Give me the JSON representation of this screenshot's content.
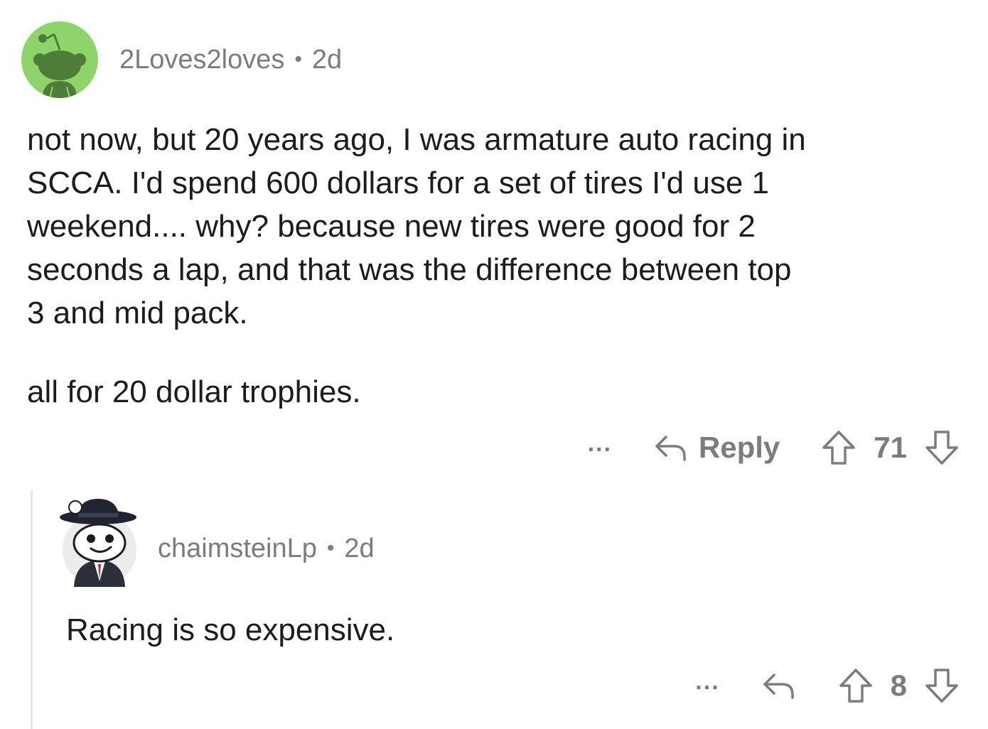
{
  "comment": {
    "username": "2Loves2loves",
    "separator": "•",
    "age": "2d",
    "paragraph1": "not now, but 20 years ago, I was armature auto racing in\nSCCA.  I'd spend 600 dollars for a set of tires I'd use 1\nweekend.... why?  because new tires were good for 2\nseconds a lap, and that was the difference between top\n3 and mid pack.",
    "paragraph2": "all for 20 dollar trophies.",
    "more_label": "...",
    "reply_label": "Reply",
    "score": "71",
    "avatar_color": "#8fd46b"
  },
  "reply": {
    "username": "chaimsteinLp",
    "separator": "•",
    "age": "2d",
    "body": "Racing is so expensive.",
    "more_label": "...",
    "score": "8"
  },
  "colors": {
    "meta_text": "#7c7c7c",
    "body_text": "#1c1c1c",
    "thread_line": "#e6e6e6"
  }
}
